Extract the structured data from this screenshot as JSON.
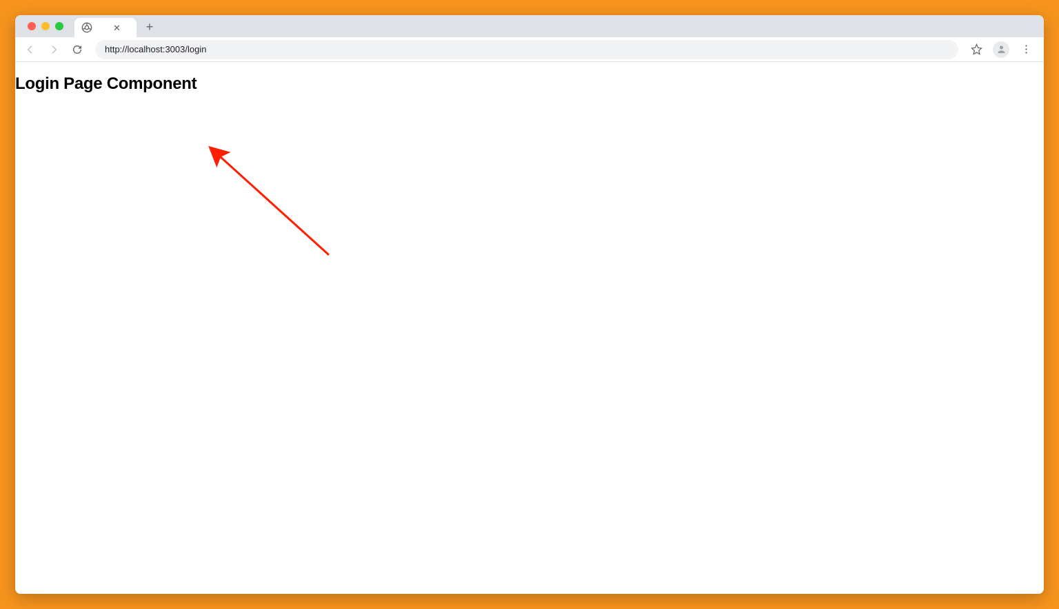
{
  "browser": {
    "url": "http://localhost:3003/login"
  },
  "page": {
    "heading": "Login Page Component"
  },
  "annotation": {
    "arrow_color": "#ff0000"
  }
}
